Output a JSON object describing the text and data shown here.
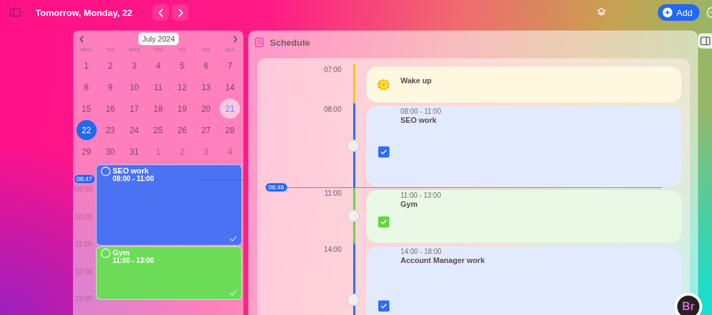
{
  "topbar": {
    "title": "Tomorrow, Monday, 22",
    "add_label": "Add"
  },
  "calendar": {
    "month": "July 2024",
    "weekdays": [
      "Mon",
      "Tue",
      "Wed",
      "Thu",
      "Fri",
      "Sat",
      "Sun"
    ],
    "days": [
      {
        "label": "1",
        "outside": false,
        "today": false,
        "selected": false
      },
      {
        "label": "2",
        "outside": false,
        "today": false,
        "selected": false
      },
      {
        "label": "3",
        "outside": false,
        "today": false,
        "selected": false
      },
      {
        "label": "4",
        "outside": false,
        "today": false,
        "selected": false
      },
      {
        "label": "5",
        "outside": false,
        "today": false,
        "selected": false
      },
      {
        "label": "6",
        "outside": false,
        "today": false,
        "selected": false
      },
      {
        "label": "7",
        "outside": false,
        "today": false,
        "selected": false
      },
      {
        "label": "8",
        "outside": false,
        "today": false,
        "selected": false
      },
      {
        "label": "9",
        "outside": false,
        "today": false,
        "selected": false
      },
      {
        "label": "10",
        "outside": false,
        "today": false,
        "selected": false
      },
      {
        "label": "11",
        "outside": false,
        "today": false,
        "selected": false
      },
      {
        "label": "12",
        "outside": false,
        "today": false,
        "selected": false
      },
      {
        "label": "13",
        "outside": false,
        "today": false,
        "selected": false
      },
      {
        "label": "14",
        "outside": false,
        "today": false,
        "selected": false
      },
      {
        "label": "15",
        "outside": false,
        "today": false,
        "selected": false
      },
      {
        "label": "16",
        "outside": false,
        "today": false,
        "selected": false
      },
      {
        "label": "17",
        "outside": false,
        "today": false,
        "selected": false
      },
      {
        "label": "18",
        "outside": false,
        "today": false,
        "selected": false
      },
      {
        "label": "19",
        "outside": false,
        "today": false,
        "selected": false
      },
      {
        "label": "20",
        "outside": false,
        "today": false,
        "selected": false
      },
      {
        "label": "21",
        "outside": false,
        "today": true,
        "selected": false
      },
      {
        "label": "22",
        "outside": false,
        "today": false,
        "selected": true
      },
      {
        "label": "23",
        "outside": false,
        "today": false,
        "selected": false
      },
      {
        "label": "24",
        "outside": false,
        "today": false,
        "selected": false
      },
      {
        "label": "25",
        "outside": false,
        "today": false,
        "selected": false
      },
      {
        "label": "26",
        "outside": false,
        "today": false,
        "selected": false
      },
      {
        "label": "27",
        "outside": false,
        "today": false,
        "selected": false
      },
      {
        "label": "28",
        "outside": false,
        "today": false,
        "selected": false
      },
      {
        "label": "29",
        "outside": false,
        "today": false,
        "selected": false
      },
      {
        "label": "30",
        "outside": false,
        "today": false,
        "selected": false
      },
      {
        "label": "31",
        "outside": false,
        "today": false,
        "selected": false
      },
      {
        "label": "1",
        "outside": true,
        "today": false,
        "selected": false
      },
      {
        "label": "2",
        "outside": true,
        "today": false,
        "selected": false
      },
      {
        "label": "3",
        "outside": true,
        "today": false,
        "selected": false
      },
      {
        "label": "4",
        "outside": true,
        "today": false,
        "selected": false
      }
    ]
  },
  "day_view": {
    "hours": [
      "09:00",
      "10:00",
      "11:00",
      "12:00",
      "13:00"
    ],
    "now": "08:47",
    "events": [
      {
        "title": "SEO work",
        "time": "08:00 - 11:00",
        "color": "#4a72f2"
      },
      {
        "title": "Gym",
        "time": "11:00 - 13:00",
        "color": "#6cdc58"
      }
    ]
  },
  "schedule": {
    "title": "Schedule",
    "now": "08:46",
    "items": [
      {
        "kind": "wake",
        "time_label": "07:00",
        "title": "Wake up",
        "color": "#f5c800"
      },
      {
        "kind": "task",
        "time_label": "08:00",
        "range": "08:00 - 11:00",
        "title": "SEO work",
        "color": "#2f6df6",
        "checked": true
      },
      {
        "kind": "task",
        "time_label": "11:00",
        "range": "11:00 - 13:00",
        "title": "Gym",
        "color": "#62d646",
        "checked": true
      },
      {
        "kind": "task",
        "time_label": "14:00",
        "range": "14:00 - 18:00",
        "title": "Account Manager work",
        "color": "#2f6df6",
        "checked": true
      }
    ]
  },
  "badge": "Br"
}
